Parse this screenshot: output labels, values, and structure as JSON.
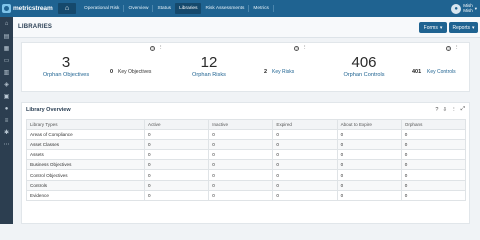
{
  "brand": {
    "name": "metricstream"
  },
  "nav": {
    "items": [
      {
        "label": "Operational Risk"
      },
      {
        "label": "Overview"
      },
      {
        "label": "Status"
      },
      {
        "label": "Libraries"
      },
      {
        "label": "Risk Assessments"
      },
      {
        "label": "Metrics"
      }
    ],
    "active": "Libraries"
  },
  "user": {
    "line1": "Mish",
    "line2": "Mish"
  },
  "page": {
    "title": "LIBRARIES"
  },
  "buttons": {
    "forms": "Forms",
    "reports": "Reports"
  },
  "summary": {
    "metrics": [
      {
        "value": "3",
        "label": "Orphan Objectives",
        "key_value": "0",
        "key_label": "Key Objectives"
      },
      {
        "value": "12",
        "label": "Orphan Risks",
        "key_value": "2",
        "key_label": "Key Risks"
      },
      {
        "value": "406",
        "label": "Orphan Controls",
        "key_value": "401",
        "key_label": "Key Controls"
      }
    ]
  },
  "overview": {
    "title": "Library Overview",
    "columns": [
      "Library Types",
      "Active",
      "Inactive",
      "Expired",
      "About to Expire",
      "Orphans"
    ],
    "rows": [
      [
        "Areas of Compliance",
        "0",
        "0",
        "0",
        "0",
        "0"
      ],
      [
        "Asset Classes",
        "0",
        "0",
        "0",
        "0",
        "0"
      ],
      [
        "Assets",
        "0",
        "0",
        "0",
        "0",
        "0"
      ],
      [
        "Business Objectives",
        "0",
        "0",
        "0",
        "0",
        "0"
      ],
      [
        "Control Objectives",
        "0",
        "0",
        "0",
        "0",
        "0"
      ],
      [
        "Controls",
        "0",
        "0",
        "0",
        "0",
        "0"
      ],
      [
        "Evidence",
        "0",
        "0",
        "0",
        "0",
        "0"
      ]
    ]
  }
}
